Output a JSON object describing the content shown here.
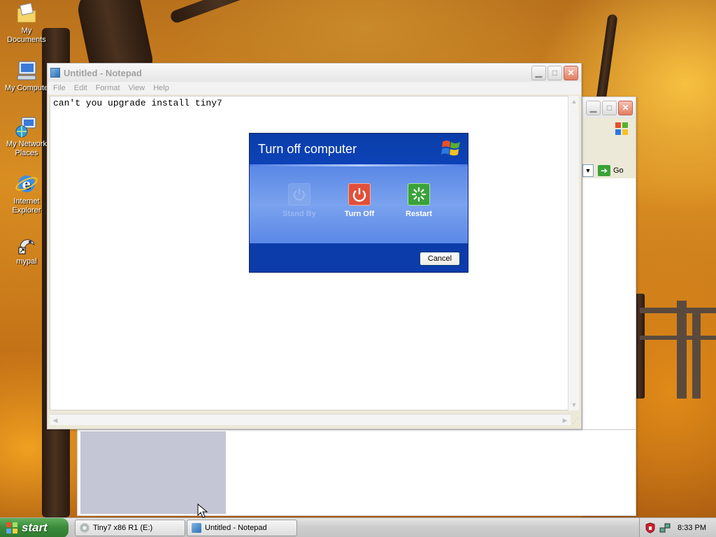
{
  "desktop": {
    "icons": [
      {
        "label": "My Documents",
        "icon": "documents-folder-icon"
      },
      {
        "label": "My Compute",
        "icon": "computer-icon"
      },
      {
        "label": "My Network Places",
        "icon": "network-places-icon"
      },
      {
        "label": "Internet Explorer",
        "icon": "internet-explorer-icon"
      },
      {
        "label": "mypal",
        "icon": "mypal-shortcut-icon"
      }
    ]
  },
  "notepad": {
    "title": "Untitled - Notepad",
    "menu": [
      "File",
      "Edit",
      "Format",
      "View",
      "Help"
    ],
    "content": "can't you upgrade install tiny7"
  },
  "explorer_window": {
    "go_label": "Go"
  },
  "shutdown_dialog": {
    "title": "Turn off computer",
    "options": [
      {
        "label": "Stand By",
        "icon": "power-icon",
        "enabled": false,
        "color": "#7aa2ee"
      },
      {
        "label": "Turn Off",
        "icon": "power-off-icon",
        "enabled": true,
        "color": "#e0503a"
      },
      {
        "label": "Restart",
        "icon": "restart-icon",
        "enabled": true,
        "color": "#3aa23a"
      }
    ],
    "cancel_label": "Cancel"
  },
  "taskbar": {
    "start_label": "start",
    "tasks": [
      {
        "label": "Tiny7 x86 R1 (E:)",
        "icon": "cd-drive-icon",
        "active": false
      },
      {
        "label": "Untitled - Notepad",
        "icon": "notepad-icon",
        "active": false
      }
    ],
    "clock": "8:33 PM",
    "tray_icons": [
      "security-shield-icon",
      "network-icon"
    ]
  },
  "colors": {
    "dialog_blue": "#0c3caa",
    "dialog_body": "#6a95ea",
    "start_green": "#3c8c3c"
  }
}
